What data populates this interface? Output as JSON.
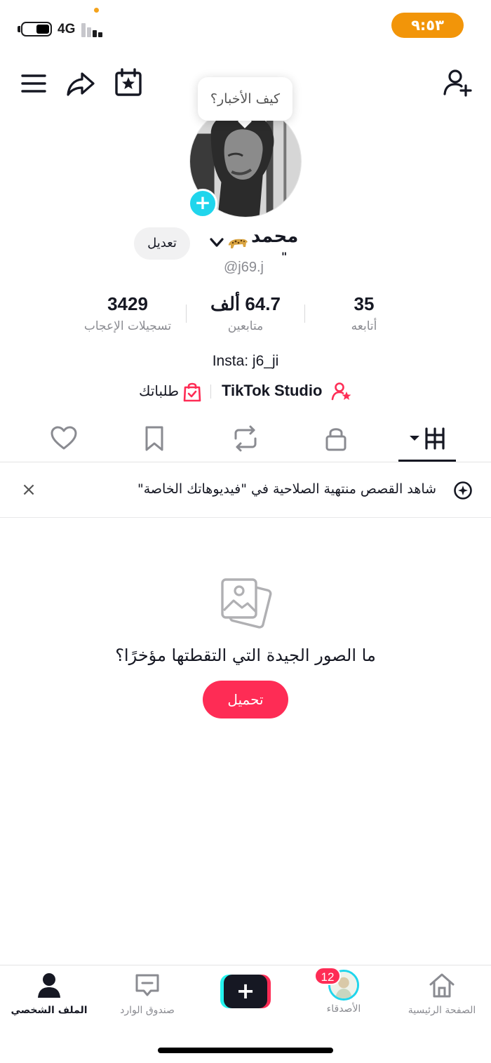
{
  "status_bar": {
    "network": "4G",
    "time": "٩:٥٣",
    "colors": {
      "time_pill": "#f29509",
      "privacy_dot": "#f4a31c"
    }
  },
  "header": {
    "icons": [
      "menu-icon",
      "share-icon",
      "calendar-star-icon",
      "add-friend-icon"
    ]
  },
  "tooltip": {
    "text": "كيف الأخبار؟"
  },
  "profile": {
    "display_name": "محمد",
    "name_suffix_mark": "\"",
    "handle": "@j69.j",
    "edit_label": "تعديل"
  },
  "stats": [
    {
      "value": "3429",
      "label": "تسجيلات الإعجاب"
    },
    {
      "value": "64.7 ألف",
      "label": "متابعين"
    },
    {
      "value": "35",
      "label": "أتابعه"
    }
  ],
  "bio": {
    "text": "Insta: j6_ji"
  },
  "links": {
    "studio": "TikTok Studio",
    "orders": "طلباتك"
  },
  "tabs": [
    {
      "icon": "grid-icon",
      "active": true
    },
    {
      "icon": "lock-icon",
      "active": false
    },
    {
      "icon": "repost-icon",
      "active": false
    },
    {
      "icon": "bookmark-icon",
      "active": false
    },
    {
      "icon": "heart-icon",
      "active": false
    }
  ],
  "banner": {
    "text": "شاهد القصص منتهية الصلاحية في \"فيديوهاتك الخاصة\"",
    "close": "×"
  },
  "empty_state": {
    "title": "ما الصور الجيدة التي التقطتها مؤخرًا؟",
    "upload_label": "تحميل"
  },
  "bottom_nav": {
    "home": "الصفحة الرئيسية",
    "friends": "الأصدقاء",
    "friends_badge": "12",
    "inbox": "صندوق الوارد",
    "profile": "الملف الشخصي",
    "create": "+"
  },
  "colors": {
    "accent": "#fe2c55",
    "cyan": "#25f4ee",
    "text": "#161823",
    "muted": "#8a8b91"
  }
}
